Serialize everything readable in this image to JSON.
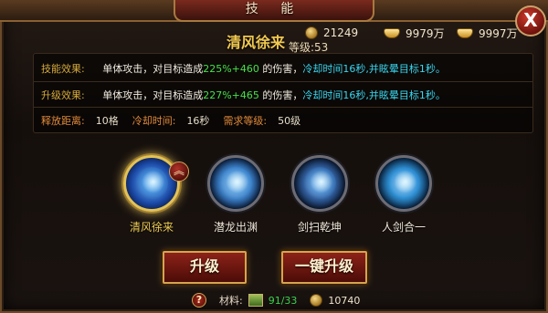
{
  "window": {
    "title": "技 能",
    "close_glyph": "X"
  },
  "currencies": [
    {
      "icon": "coin-icon",
      "value": "21249"
    },
    {
      "icon": "gold-ingot-icon",
      "value": "9979万"
    },
    {
      "icon": "bound-ingot-icon",
      "value": "9997万"
    }
  ],
  "skill_detail": {
    "name": "清风徐来",
    "level": "等级:53",
    "current_effect": {
      "label": "技能效果:",
      "part1": "单体攻击，对目标造成",
      "formula": "225%+460",
      "part2": "的伤害，",
      "part3": "冷却时间16秒,",
      "part4": "并眩晕目标1秒。"
    },
    "upgrade_effect": {
      "label": "升级效果:",
      "part1": "单体攻击，对目标造成",
      "formula": "227%+465",
      "part2": "的伤害，",
      "part3": "冷却时间16秒,",
      "part4": "并眩晕目标1秒。"
    },
    "range_label": "释放距离:",
    "range_value": "10格",
    "cooldown_label": "冷却时间:",
    "cooldown_value": "16秒",
    "req_level_label": "需求等级:",
    "req_level_value": "50级"
  },
  "skills": [
    {
      "name": "清风徐来",
      "icon": "wind-blade-skill-icon",
      "selected": true
    },
    {
      "name": "潜龙出渊",
      "icon": "dragon-skill-icon",
      "selected": false
    },
    {
      "name": "剑扫乾坤",
      "icon": "sword-sweep-skill-icon",
      "selected": false
    },
    {
      "name": "人剑合一",
      "icon": "sword-unity-skill-icon",
      "selected": false
    }
  ],
  "upgrade_badge_glyph": "︽",
  "buttons": {
    "upgrade": "升级",
    "one_click_upgrade": "一键升级"
  },
  "footer": {
    "help_glyph": "?",
    "material_label": "材料:",
    "material_count": "91/33",
    "gold_cost": "10740"
  },
  "colors": {
    "accent_gold": "#f0c850",
    "green_text": "#47e04a",
    "cyan_text": "#39d6ef",
    "label_orange": "#d6a93c",
    "button_red": "#8c2219"
  }
}
